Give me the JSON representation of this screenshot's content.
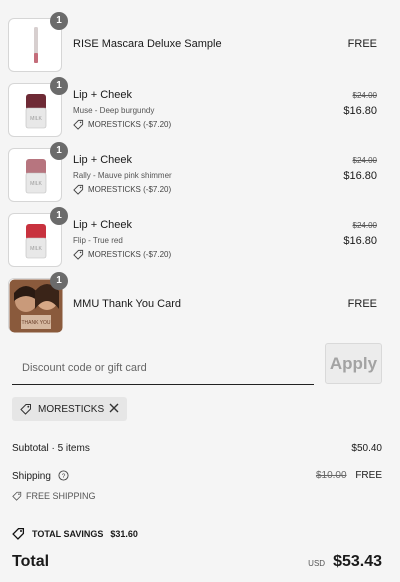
{
  "line_items": [
    {
      "name": "RISE Mascara Deluxe Sample",
      "variant": "",
      "code": "",
      "price_old": "",
      "price": "FREE",
      "qty": "1",
      "thumb": "mascara"
    },
    {
      "name": "Lip + Cheek",
      "variant": "Muse - Deep burgundy",
      "code": "MORESTICKS (-$7.20)",
      "price_old": "$24.00",
      "price": "$16.80",
      "qty": "1",
      "thumb": "stick"
    },
    {
      "name": "Lip + Cheek",
      "variant": "Rally - Mauve pink shimmer",
      "code": "MORESTICKS (-$7.20)",
      "price_old": "$24.00",
      "price": "$16.80",
      "qty": "1",
      "thumb": "stick"
    },
    {
      "name": "Lip + Cheek",
      "variant": "Flip - True red",
      "code": "MORESTICKS (-$7.20)",
      "price_old": "$24.00",
      "price": "$16.80",
      "qty": "1",
      "thumb": "stick"
    },
    {
      "name": "MMU Thank You Card",
      "variant": "",
      "code": "",
      "price_old": "",
      "price": "FREE",
      "qty": "1",
      "thumb": "photo"
    }
  ],
  "discount": {
    "placeholder": "Discount code or gift card",
    "apply_label": "Apply"
  },
  "applied_code": "MORESTICKS",
  "summary": {
    "subtotal_label": "Subtotal · 5 items",
    "subtotal_value": "$50.40",
    "shipping_label": "Shipping",
    "shipping_old": "$10.00",
    "shipping_value": "FREE",
    "free_shipping_note": "FREE SHIPPING",
    "savings_label": "TOTAL SAVINGS",
    "savings_value": "$31.60",
    "total_label": "Total",
    "currency": "USD",
    "total_value": "$53.43"
  },
  "colors": {
    "badge": "#6b6b6b",
    "page_bg": "#f5f5f5"
  }
}
